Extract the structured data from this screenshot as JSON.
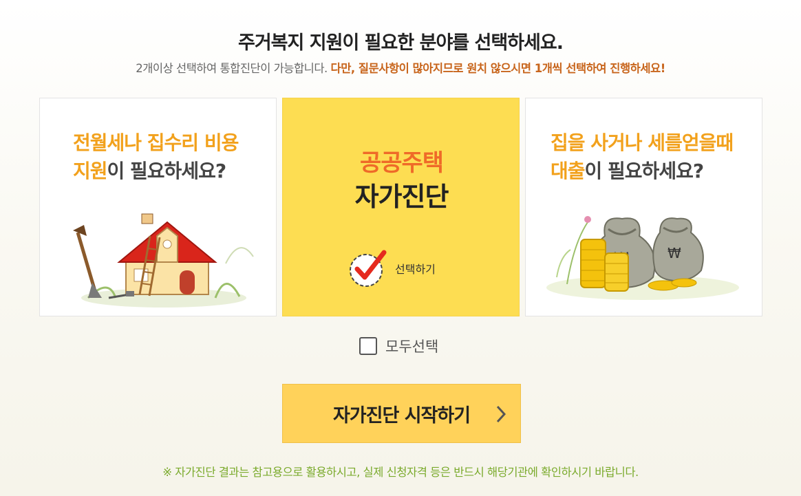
{
  "header": {
    "title": "주거복지 지원이 필요한 분야를 선택하세요.",
    "subtitle_plain": "2개이상 선택하여 통합진단이 가능합니다. ",
    "subtitle_warning": "다만, 질문사항이 많아지므로 원치 않으시면 1개씩 선택하여 진행하세요!"
  },
  "cards": [
    {
      "line1": "전월세나 집수리 비용",
      "line2_accent": "지원",
      "line2_rest": "이 필요하세요?",
      "image": "house-illustration",
      "selected": false
    },
    {
      "line1": "공공주택",
      "line2": "자가진단",
      "check_label": "선택하기",
      "icon": "check-icon",
      "selected": true
    },
    {
      "line1": "집을 사거나 세를얻을때",
      "line2_accent": "대출",
      "line2_rest": "이 필요하세요?",
      "image": "money-bags-illustration",
      "selected": false
    }
  ],
  "select_all": {
    "label": "모두선택",
    "checked": false
  },
  "start_button": {
    "label": "자가진단 시작하기",
    "icon": "chevron-right-icon"
  },
  "notice": "※ 자가진단 결과는 참고용으로 활용하시고, 실제 신청자격 등은 반드시 해당기관에 확인하시기 바랍니다.",
  "colors": {
    "accent_orange": "#f2a11c",
    "warning": "#c8651c",
    "selected_card": "#fddd52",
    "button": "#ffd25a",
    "notice_green": "#7aaa2c"
  }
}
